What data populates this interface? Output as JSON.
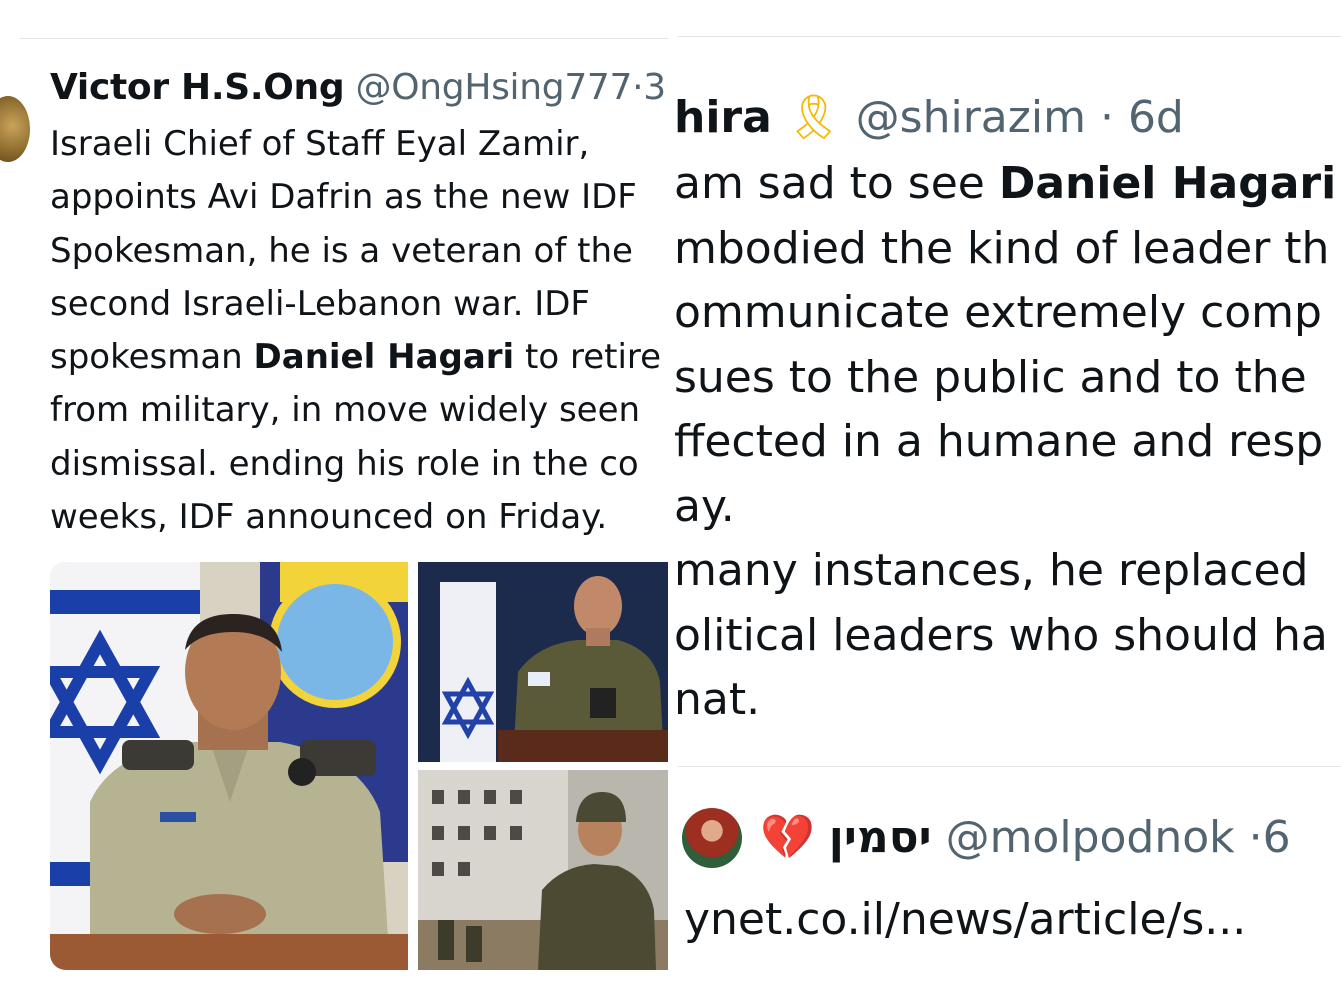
{
  "left_tweet": {
    "display_name": "Victor H.S.Ong",
    "handle": "@OngHsing777",
    "separator": "·",
    "time_partial": "3",
    "lines": [
      {
        "pre": "Israeli Chief of Staff Eyal Zamir,",
        "bold": "",
        "post": ""
      },
      {
        "pre": "appoints Avi Dafrin as the new IDF",
        "bold": "",
        "post": ""
      },
      {
        "pre": "Spokesman, he is a veteran of the",
        "bold": "",
        "post": ""
      },
      {
        "pre": "second Israeli-Lebanon war. IDF",
        "bold": "",
        "post": ""
      },
      {
        "pre": "spokesman ",
        "bold": "Daniel Hagari",
        "post": " to retire"
      },
      {
        "pre": "from military, in move widely seen",
        "bold": "",
        "post": ""
      },
      {
        "pre": "dismissal. ending his role in the co",
        "bold": "",
        "post": ""
      },
      {
        "pre": "weeks, IDF announced on Friday.",
        "bold": "",
        "post": ""
      }
    ],
    "media": {
      "main_alt": "officer-portrait-photo",
      "top_alt": "spokesman-podium-photo",
      "bottom_alt": "soldier-field-photo"
    }
  },
  "right_tweet_1": {
    "display_name": "hira",
    "emoji": "🎗",
    "handle": "@shirazim",
    "separator": "·",
    "time": "6d",
    "lines": [
      {
        "pre": "am sad to see ",
        "bold": "Daniel Hagari",
        "post": ""
      },
      {
        "pre": "mbodied the kind of leader th",
        "bold": "",
        "post": ""
      },
      {
        "pre": "ommunicate extremely comp",
        "bold": "",
        "post": ""
      },
      {
        "pre": "sues to the public and to the",
        "bold": "",
        "post": ""
      },
      {
        "pre": "ffected in a humane and resp",
        "bold": "",
        "post": ""
      },
      {
        "pre": "ay.",
        "bold": "",
        "post": ""
      },
      {
        "pre": " many instances, he replaced",
        "bold": "",
        "post": ""
      },
      {
        "pre": "olitical leaders who should ha",
        "bold": "",
        "post": ""
      },
      {
        "pre": "nat.",
        "bold": "",
        "post": ""
      }
    ]
  },
  "right_tweet_2": {
    "emoji": "💔",
    "display_name": "יסמין",
    "handle": "@molpodnok",
    "separator": "·",
    "time_partial": "6",
    "link": "ynet.co.il/news/article/s..."
  },
  "colors": {
    "text": "#0f1419",
    "secondary": "#536471",
    "divider": "#e3e6e8",
    "ribbon": "#f5b800",
    "heart": "#d9202b"
  }
}
